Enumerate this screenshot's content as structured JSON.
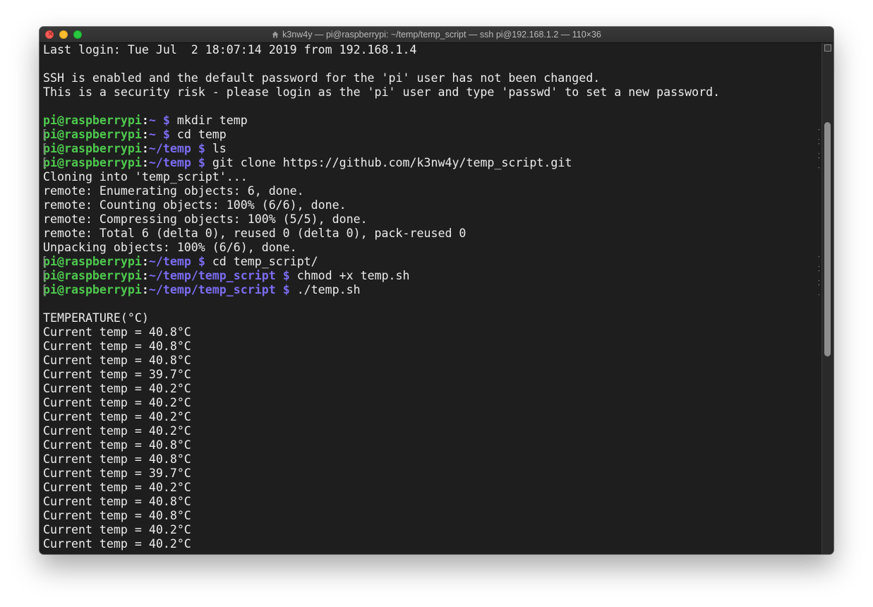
{
  "window": {
    "title": "k3nw4y — pi@raspberrypi: ~/temp/temp_script — ssh pi@192.168.1.2 — 110×36",
    "proxy_icon": "house-icon"
  },
  "terminal": {
    "intro": [
      "Last login: Tue Jul  2 18:07:14 2019 from 192.168.1.4",
      "",
      "SSH is enabled and the default password for the 'pi' user has not been changed.",
      "This is a security risk - please login as the 'pi' user and type 'passwd' to set a new password.",
      ""
    ],
    "prompt_user": "pi@raspberrypi",
    "prompt_colon": ":",
    "commands": [
      {
        "path": "~",
        "cmd": "mkdir temp"
      },
      {
        "path": "~",
        "cmd": "cd temp"
      },
      {
        "path": "~/temp",
        "cmd": "ls"
      },
      {
        "path": "~/temp",
        "cmd": "git clone https://github.com/k3nw4y/temp_script.git"
      }
    ],
    "clone_output": [
      "Cloning into 'temp_script'...",
      "remote: Enumerating objects: 6, done.",
      "remote: Counting objects: 100% (6/6), done.",
      "remote: Compressing objects: 100% (5/5), done.",
      "remote: Total 6 (delta 0), reused 0 (delta 0), pack-reused 0",
      "Unpacking objects: 100% (6/6), done."
    ],
    "commands2": [
      {
        "path": "~/temp",
        "cmd": "cd temp_script/"
      },
      {
        "path": "~/temp/temp_script",
        "cmd": "chmod +x temp.sh"
      },
      {
        "path": "~/temp/temp_script",
        "cmd": "./temp.sh"
      }
    ],
    "temp_header": "TEMPERATURE(°C)",
    "temp_label": "Current temp = ",
    "temps": [
      "40.8°C",
      "40.8°C",
      "40.8°C",
      "39.7°C",
      "40.2°C",
      "40.2°C",
      "40.2°C",
      "40.2°C",
      "40.8°C",
      "40.8°C",
      "39.7°C",
      "40.2°C",
      "40.8°C",
      "40.8°C",
      "40.2°C",
      "40.2°C"
    ]
  },
  "colors": {
    "user": "#4ec94e",
    "path": "#7b6cf0",
    "text": "#ececec",
    "background": "#1e1e1e"
  }
}
